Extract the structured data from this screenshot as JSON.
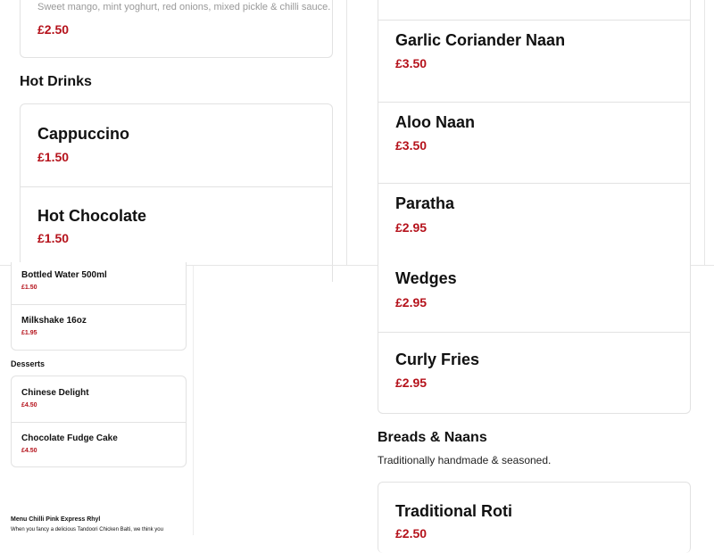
{
  "top_left": {
    "item_desc": "Sweet mango, mint yoghurt, red onions, mixed pickle & chilli sauce.",
    "item_price": "£2.50",
    "section_heading": "Hot Drinks",
    "items": [
      {
        "name": "Cappuccino",
        "price": "£1.50"
      },
      {
        "name": "Hot Chocolate",
        "price": "£1.50"
      }
    ]
  },
  "top_right": {
    "items": [
      {
        "name": "Garlic Coriander Naan",
        "price": "£3.50"
      },
      {
        "name": "Aloo Naan",
        "price": "£3.50"
      },
      {
        "name": "Paratha",
        "price": "£2.95"
      }
    ]
  },
  "bottom_left": {
    "drinks": [
      {
        "name": "Bottled Water 500ml",
        "price": "£1.50"
      },
      {
        "name": "Milkshake 16oz",
        "price": "£1.95"
      }
    ],
    "desserts_heading": "Desserts",
    "desserts": [
      {
        "name": "Chinese Delight",
        "price": "£4.50"
      },
      {
        "name": "Chocolate Fudge Cake",
        "price": "£4.50"
      }
    ],
    "footer_title": "Menu Chilli Pink Express Rhyl",
    "footer_text": "When you fancy a delicious Tandoori Chicken Balti, we think you"
  },
  "bottom_right": {
    "sides": [
      {
        "name": "Wedges",
        "price": "£2.95"
      },
      {
        "name": "Curly Fries",
        "price": "£2.95"
      }
    ],
    "breads_heading": "Breads & Naans",
    "breads_sub": "Traditionally handmade & seasoned.",
    "breads": [
      {
        "name": "Traditional Roti",
        "price": "£2.50"
      }
    ]
  },
  "colors": {
    "price": "#b5121b",
    "border": "#e2e2e2"
  }
}
